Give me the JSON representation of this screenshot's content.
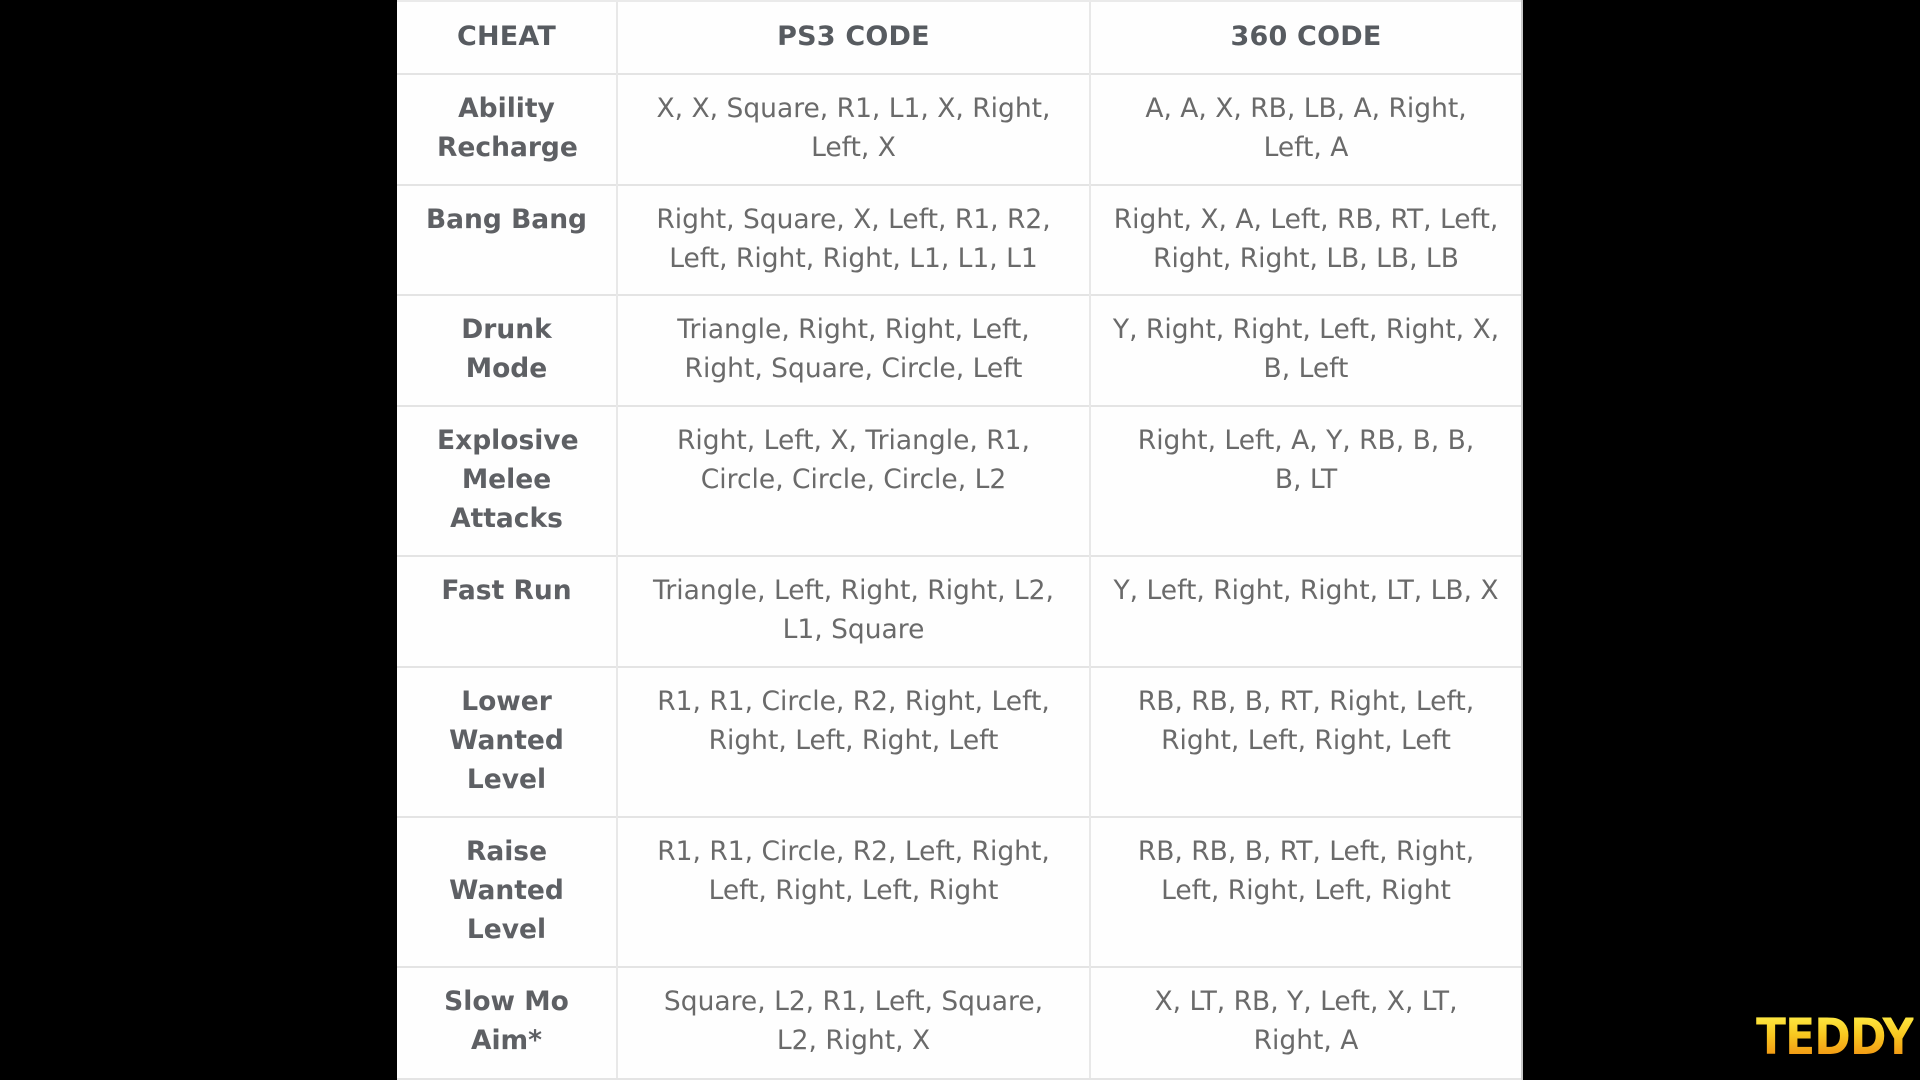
{
  "table": {
    "headers": [
      "CHEAT",
      "PS3 CODE",
      "360 CODE"
    ],
    "rows": [
      {
        "cheat": "Ability Recharge",
        "ps3": "X, X, Square, R1, L1, X, Right, Left, X",
        "x360": "A, A, X, RB, LB, A, Right, Left, A"
      },
      {
        "cheat": "Bang Bang",
        "ps3": "Right, Square, X, Left, R1, R2, Left, Right, Right, L1, L1, L1",
        "x360": "Right, X, A, Left, RB, RT, Left, Right, Right, LB, LB, LB"
      },
      {
        "cheat": "Drunk Mode",
        "ps3": "Triangle, Right, Right, Left, Right, Square, Circle, Left",
        "x360": "Y, Right, Right, Left, Right, X, B, Left"
      },
      {
        "cheat": "Explosive Melee Attacks",
        "ps3": "Right, Left, X, Triangle, R1, Circle, Circle, Circle, L2",
        "x360": "Right, Left, A, Y, RB, B, B, B, LT"
      },
      {
        "cheat": "Fast Run",
        "ps3": "Triangle, Left, Right, Right, L2, L1, Square",
        "x360": "Y, Left, Right, Right, LT, LB, X"
      },
      {
        "cheat": "Lower Wanted Level",
        "ps3": "R1, R1, Circle, R2, Right, Left, Right, Left, Right, Left",
        "x360": "RB, RB, B, RT, Right, Left, Right, Left, Right, Left"
      },
      {
        "cheat": "Raise Wanted Level",
        "ps3": "R1, R1, Circle, R2, Left, Right, Left, Right, Left, Right",
        "x360": "RB, RB, B, RT, Left, Right, Left, Right, Left, Right"
      },
      {
        "cheat": "Slow Mo Aim*",
        "ps3": "Square, L2, R1, Left, Square, L2, Right, X",
        "x360": "X, LT, RB, Y, Left, X, LT, Right, A"
      }
    ]
  },
  "watermark": {
    "text": "TEDDY",
    "gradient_top": "#fff04a",
    "gradient_bottom": "#f08a10"
  }
}
